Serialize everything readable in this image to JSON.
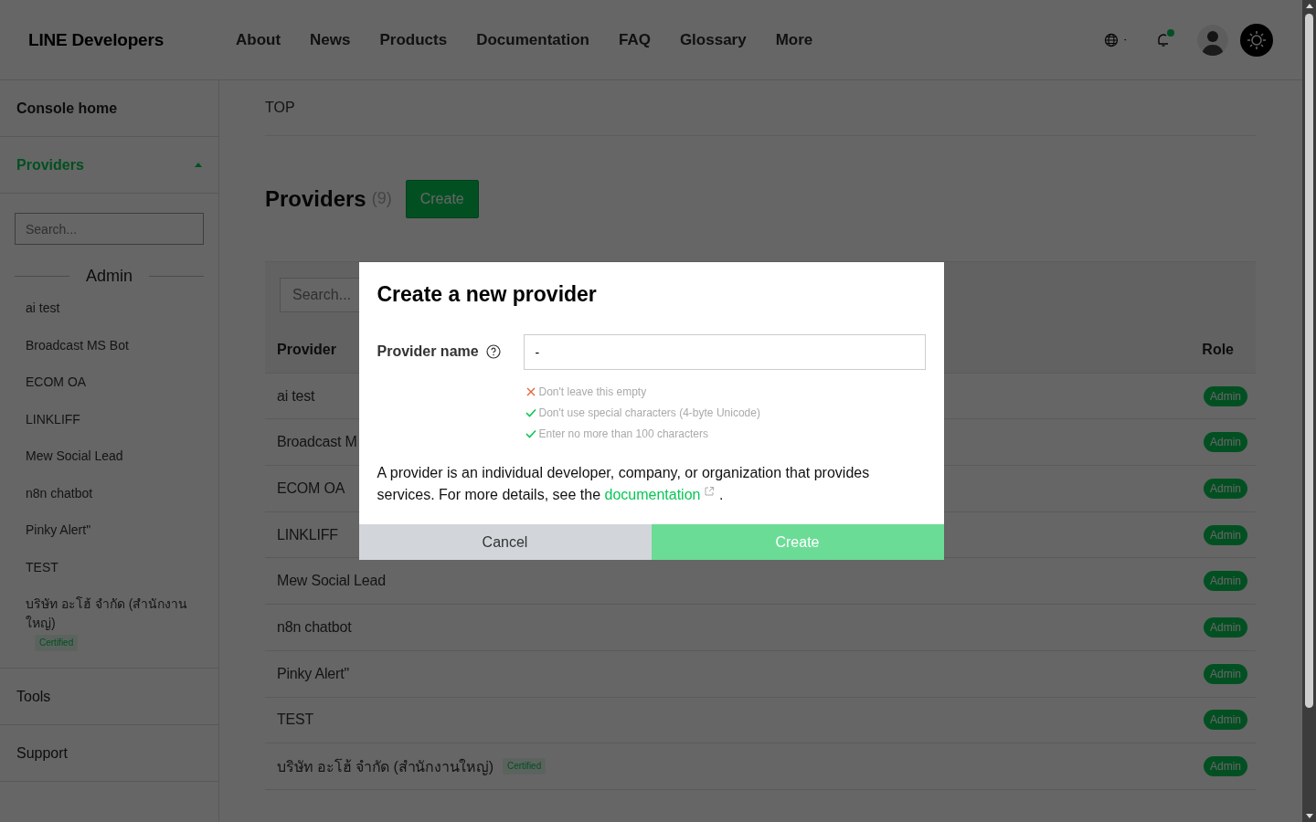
{
  "header": {
    "logo": "LINE Developers",
    "nav": [
      "About",
      "News",
      "Products",
      "Documentation",
      "FAQ",
      "Glossary",
      "More"
    ],
    "notification_unread": true
  },
  "sidebar": {
    "console_home": "Console home",
    "providers": {
      "label": "Providers",
      "expanded": true
    },
    "search": {
      "placeholder": "Search..."
    },
    "group": "Admin",
    "items": [
      {
        "name": "ai test"
      },
      {
        "name": "Broadcast MS Bot"
      },
      {
        "name": "ECOM OA"
      },
      {
        "name": "LINKLIFF"
      },
      {
        "name": "Mew Social Lead"
      },
      {
        "name": "n8n chatbot"
      },
      {
        "name": "Pinky Alert\""
      },
      {
        "name": "TEST"
      },
      {
        "name": "บริษัท อะโฮ้ จำกัด (สำนักงานใหญ่)",
        "certified": "Certified"
      }
    ],
    "links": [
      "Tools",
      "Support"
    ]
  },
  "main": {
    "breadcrumb": "TOP",
    "title": "Providers",
    "count": "(9)",
    "create_button": "Create",
    "table_search": {
      "placeholder": "Search..."
    },
    "columns": [
      "Provider",
      "Role"
    ],
    "rows": [
      {
        "name": "ai test",
        "role": "Admin"
      },
      {
        "name": "Broadcast M",
        "role": "Admin"
      },
      {
        "name": "ECOM OA",
        "role": "Admin"
      },
      {
        "name": "LINKLIFF",
        "role": "Admin"
      },
      {
        "name": "Mew Social Lead",
        "role": "Admin"
      },
      {
        "name": "n8n chatbot",
        "role": "Admin"
      },
      {
        "name": "Pinky Alert\"",
        "role": "Admin"
      },
      {
        "name": "TEST",
        "role": "Admin"
      },
      {
        "name": "บริษัท อะโฮ้ จำกัด (สำนักงานใหญ่)",
        "certified": "Certified",
        "role": "Admin"
      }
    ]
  },
  "modal": {
    "title": "Create a new provider",
    "field_label": "Provider name",
    "field_value": "-",
    "rules": [
      {
        "text": "Don't leave this empty",
        "passed": false
      },
      {
        "text": "Don't use special characters (4-byte Unicode)",
        "passed": true
      },
      {
        "text": "Enter no more than 100 characters",
        "passed": true
      }
    ],
    "description": "A provider is an individual developer, company, or organization that provides services. For more details, see the",
    "link": "documentation",
    "description_end": ".",
    "cancel": "Cancel",
    "create": {
      "label": "Create",
      "disabled": true
    }
  }
}
